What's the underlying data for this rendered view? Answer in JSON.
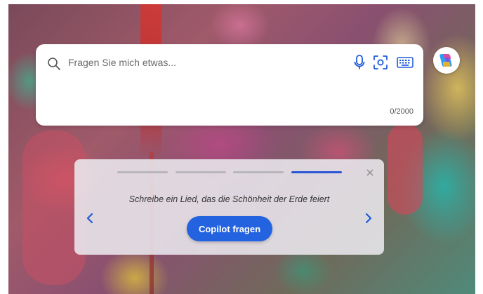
{
  "search": {
    "placeholder": "Fragen Sie mich etwas...",
    "value": "",
    "char_counter": "0/2000"
  },
  "carousel": {
    "suggestion_text": "Schreibe ein Lied, das die Schönheit der Erde feiert",
    "cta_label": "Copilot fragen",
    "active_slide": 4,
    "total_slides": 4
  },
  "icons": {
    "search": "search-icon",
    "mic": "microphone-icon",
    "lens": "visual-search-icon",
    "keyboard": "keyboard-icon",
    "copilot": "copilot-logo-icon",
    "close": "close-icon",
    "prev": "chevron-left-icon",
    "next": "chevron-right-icon"
  },
  "colors": {
    "accent": "#2463e0",
    "active_progress": "#2a56d6",
    "icon_blue": "#1f5bd8"
  }
}
